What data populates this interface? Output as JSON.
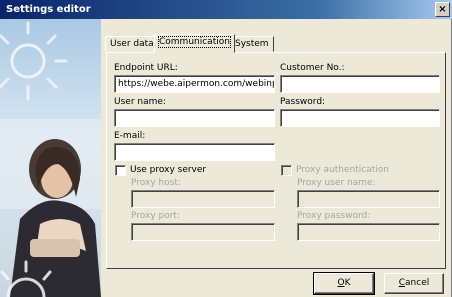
{
  "window": {
    "title": "Settings editor",
    "close_glyph": "×"
  },
  "tabs": [
    {
      "label": "User data",
      "active": false
    },
    {
      "label": "Communication",
      "active": true
    },
    {
      "label": "System",
      "active": false
    }
  ],
  "form": {
    "endpoint_url": {
      "label": "Endpoint URL:",
      "value": "https://webe.aipermon.com/webinpu"
    },
    "customer_no": {
      "label": "Customer No.:",
      "value": ""
    },
    "user_name": {
      "label": "User name:",
      "value": ""
    },
    "password": {
      "label": "Password:",
      "value": ""
    },
    "email": {
      "label": "E-mail:",
      "value": ""
    },
    "use_proxy": {
      "label": "Use proxy server",
      "checked": false
    },
    "proxy_auth": {
      "label": "Proxy authentication",
      "checked": false
    },
    "proxy_host": {
      "label": "Proxy host:",
      "value": ""
    },
    "proxy_port": {
      "label": "Proxy port:",
      "value": ""
    },
    "proxy_user": {
      "label": "Proxy user name:",
      "value": ""
    },
    "proxy_password": {
      "label": "Proxy password:",
      "value": ""
    }
  },
  "buttons": {
    "ok": {
      "mnemonic": "O",
      "rest": "K"
    },
    "cancel": {
      "mnemonic": "C",
      "rest": "ancel"
    }
  },
  "colors": {
    "title_gradient_start": "#0a246a",
    "dialog_bg": "#ece9d8",
    "disabled_text": "#a8a59a"
  }
}
